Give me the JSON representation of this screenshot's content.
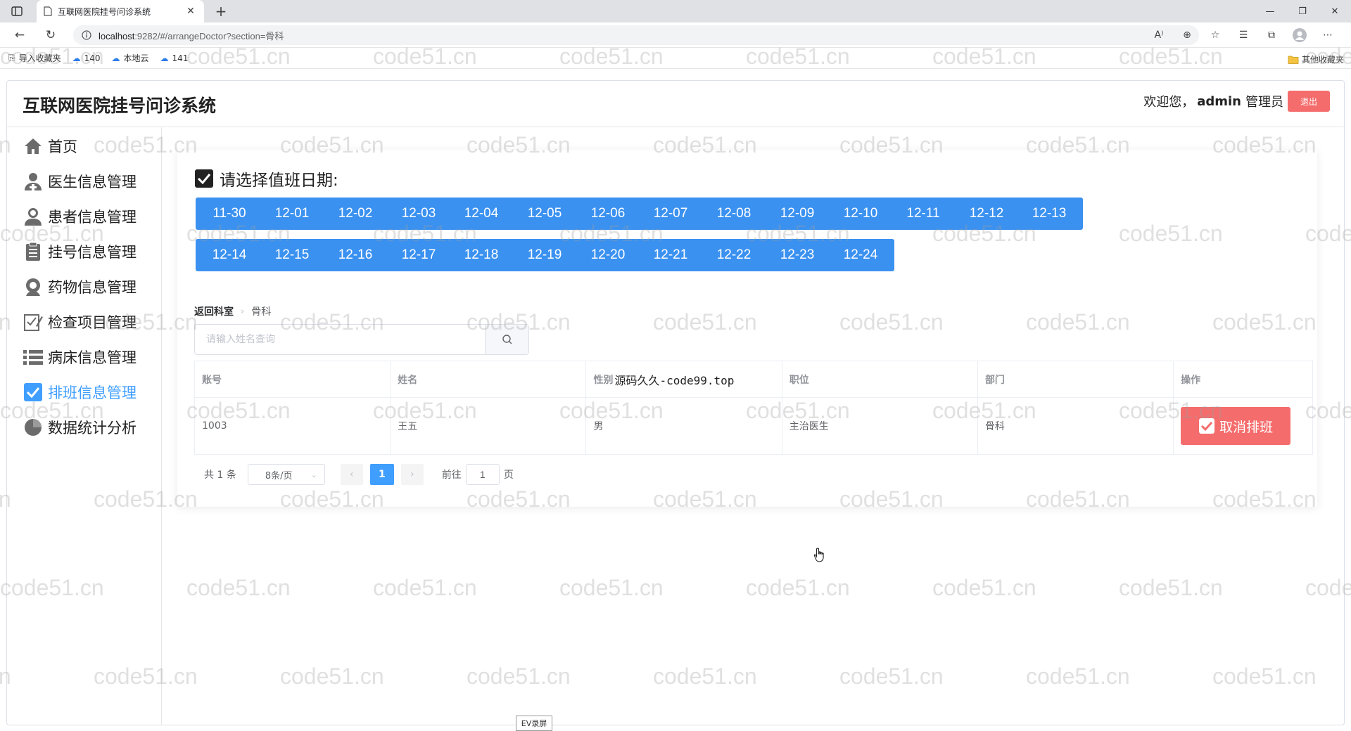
{
  "browser": {
    "tab_title": "互联网医院挂号问诊系统",
    "url_host": "localhost",
    "url_rest": ":9282/#/arrangeDoctor?section=骨科",
    "bookmarks": [
      "导入收藏夹",
      "140",
      "本地云",
      "141"
    ],
    "other_bookmarks": "其他收藏夹"
  },
  "header": {
    "title": "互联网医院挂号问诊系统",
    "welcome": "欢迎您，",
    "username": "admin",
    "role": "管理员",
    "logout": "退出"
  },
  "sidebar": {
    "items": [
      {
        "label": "首页",
        "icon": "home-icon"
      },
      {
        "label": "医生信息管理",
        "icon": "doctor-icon"
      },
      {
        "label": "患者信息管理",
        "icon": "patient-icon"
      },
      {
        "label": "挂号信息管理",
        "icon": "clipboard-icon"
      },
      {
        "label": "药物信息管理",
        "icon": "medicine-icon"
      },
      {
        "label": "检查项目管理",
        "icon": "checklist-icon"
      },
      {
        "label": "病床信息管理",
        "icon": "bed-list-icon"
      },
      {
        "label": "排班信息管理",
        "icon": "schedule-check-icon"
      },
      {
        "label": "数据统计分析",
        "icon": "stats-icon"
      }
    ],
    "active_index": 7,
    "active_color": "#409eff"
  },
  "schedule": {
    "heading": "请选择值班日期:",
    "dates": [
      "11-30",
      "12-01",
      "12-02",
      "12-03",
      "12-04",
      "12-05",
      "12-06",
      "12-07",
      "12-08",
      "12-09",
      "12-10",
      "12-11",
      "12-12",
      "12-13",
      "12-14",
      "12-15",
      "12-16",
      "12-17",
      "12-18",
      "12-19",
      "12-20",
      "12-21",
      "12-22",
      "12-23",
      "12-24"
    ],
    "date_button_color": "#3a91f0"
  },
  "breadcrumb": {
    "back": "返回科室",
    "current": "骨科"
  },
  "search": {
    "placeholder": "请输入姓名查询"
  },
  "table": {
    "headers": [
      "账号",
      "姓名",
      "性别",
      "职位",
      "部门",
      "操作"
    ],
    "gender_header_note": "源码久久-code99.top",
    "rows": [
      {
        "account": "1003",
        "name": "王五",
        "gender": "男",
        "position": "主治医生",
        "department": "骨科",
        "action": "取消排班"
      }
    ],
    "action_color": "#f56c6c"
  },
  "pagination": {
    "total": "共 1 条",
    "page_size": "8条/页",
    "current_page": "1",
    "goto_label": "前往",
    "goto_value": "1",
    "page_suffix": "页"
  },
  "watermark": "code51.cn",
  "recorder_label": "EV录屏"
}
